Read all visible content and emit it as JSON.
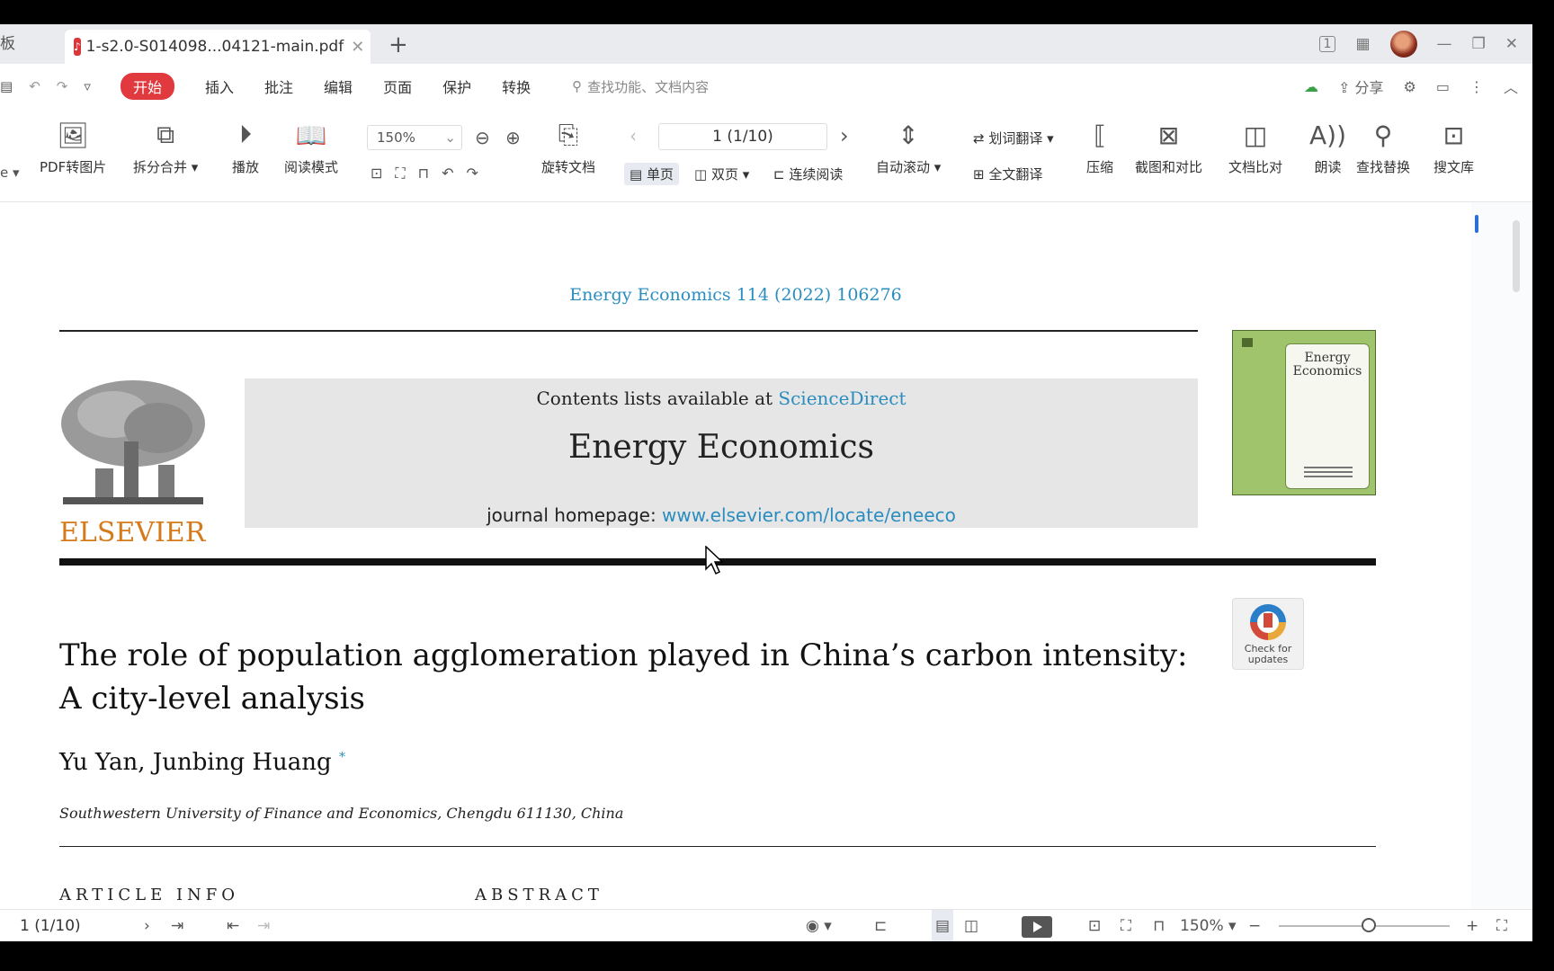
{
  "tabs": {
    "prev_label": "板",
    "active_title": "1-s2.0-S014098...04121-main.pdf",
    "active_icon": "pdf-icon",
    "add_label": "+"
  },
  "window_controls": {
    "view_label": "1",
    "grid_icon": "grid-icon",
    "min": "—",
    "max": "❐",
    "close": "✕"
  },
  "menu": {
    "start": "开始",
    "items": [
      "插入",
      "批注",
      "编辑",
      "页面",
      "保护",
      "转换"
    ],
    "search_placeholder": "查找功能、文档内容",
    "share": "分享"
  },
  "ribbon": {
    "pdf_to_image": "PDF转图片",
    "split_merge": "拆分合并",
    "play": "播放",
    "read_mode": "阅读模式",
    "zoom": "150%",
    "rotate_doc": "旋转文档",
    "page_indicator": "1 (1/10)",
    "single_page": "单页",
    "double_page": "双页",
    "continuous": "连续阅读",
    "auto_scroll": "自动滚动",
    "word_translate": "划词翻译",
    "full_translate": "全文翻译",
    "compress": "压缩",
    "screenshot_compare": "截图和对比",
    "doc_compare": "文档比对",
    "read_aloud": "朗读",
    "find_replace": "查找替换",
    "search_lib": "搜文库"
  },
  "document": {
    "journal_ref": "Energy Economics 114 (2022) 106276",
    "contents_prefix": "Contents lists available at ",
    "contents_link": "ScienceDirect",
    "journal_title": "Energy Economics",
    "homepage_prefix": "journal homepage: ",
    "homepage_url": "www.elsevier.com/locate/eneeco",
    "publisher": "ELSEVIER",
    "cover_title_1": "Energy",
    "cover_title_2": "Economics",
    "check_updates_1": "Check for",
    "check_updates_2": "updates",
    "article_title": "The role of population agglomeration played in China’s carbon intensity: A city-level analysis",
    "authors": "Yu Yan, Junbing Huang",
    "author_mark": "*",
    "affiliation": "Southwestern University of Finance and Economics, Chengdu 611130, China",
    "article_info": "ARTICLE INFO",
    "abstract": "ABSTRACT"
  },
  "statusbar": {
    "page": "1 (1/10)",
    "zoom": "150%",
    "minus": "−",
    "plus": "+"
  },
  "colors": {
    "accent_red": "#e0393e",
    "link_blue": "#2a8dbf",
    "elsevier_orange": "#d47a1a",
    "cover_green": "#9fc46c"
  }
}
